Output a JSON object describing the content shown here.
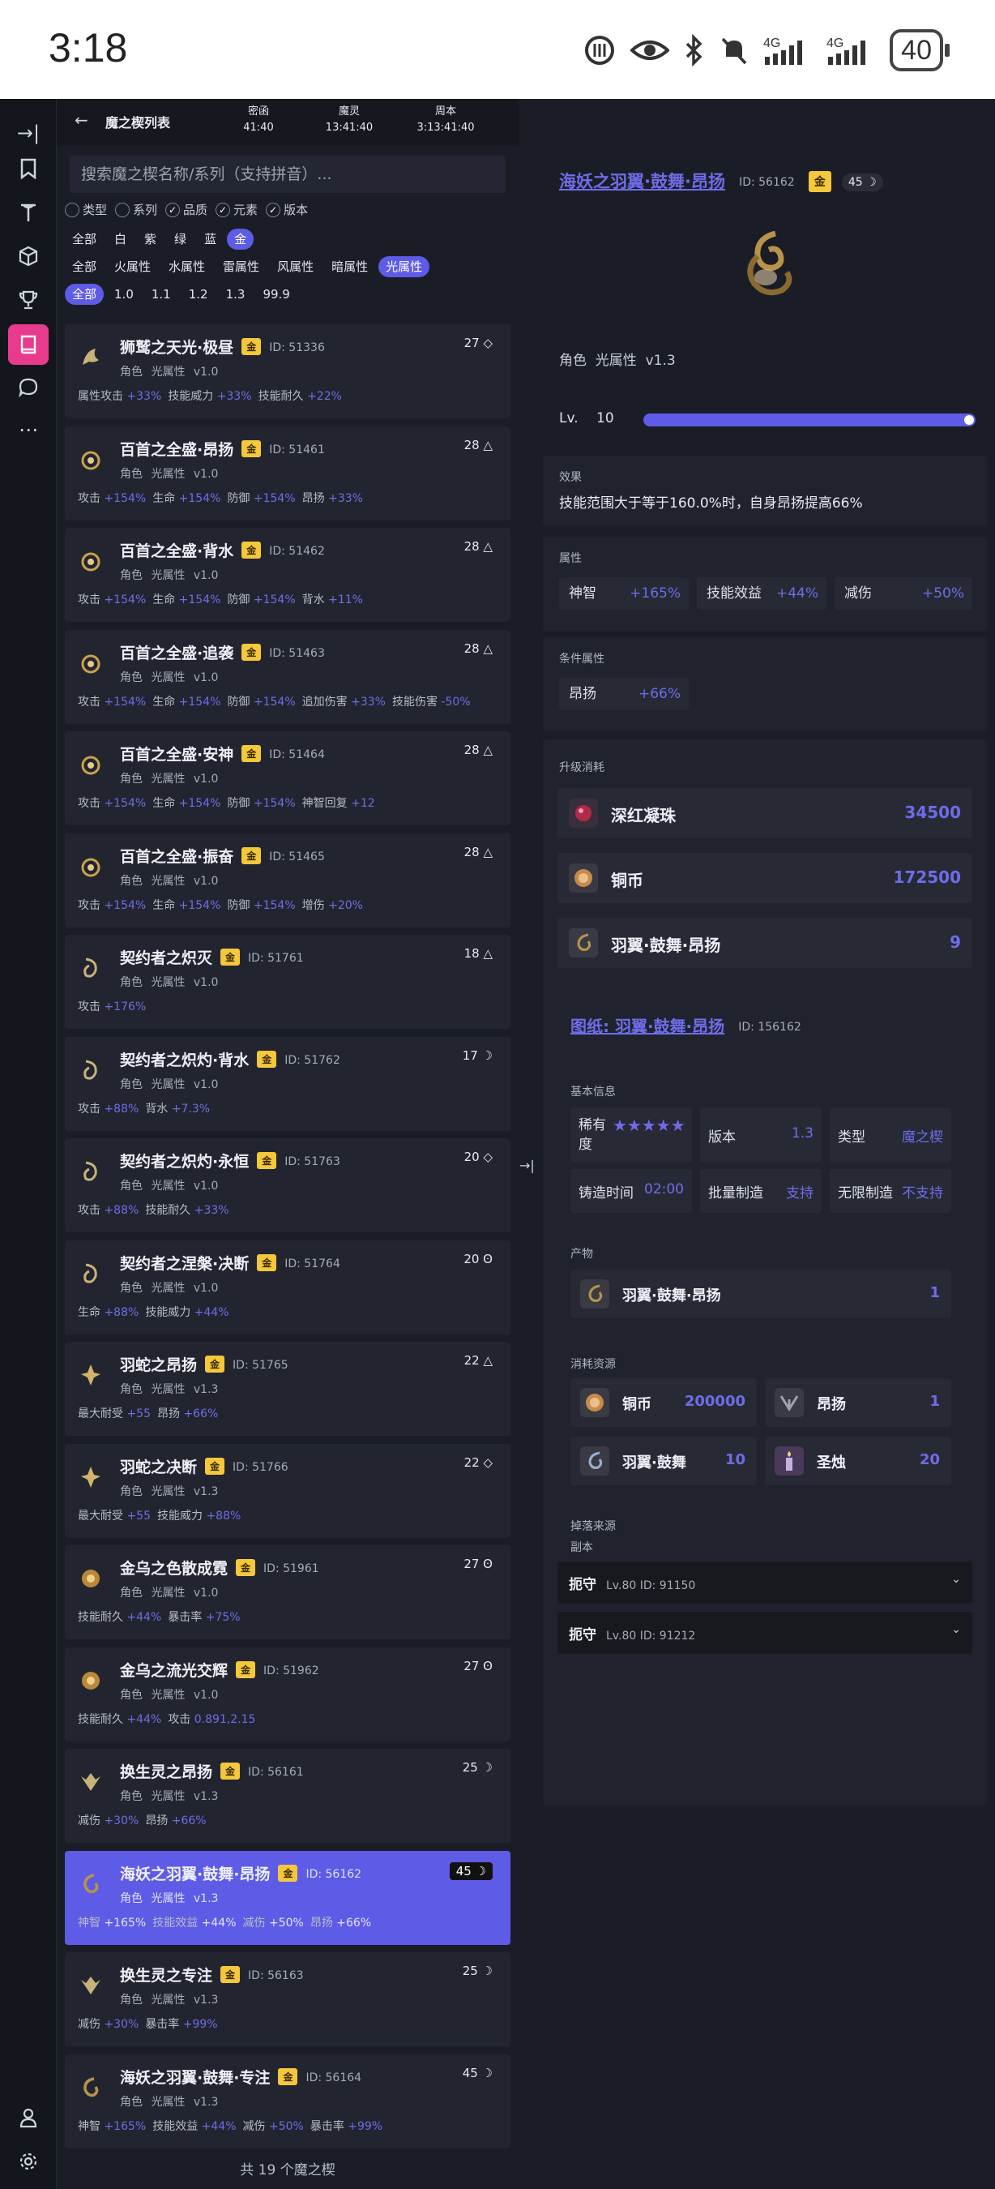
{
  "status": {
    "time": "3:18",
    "battery": "40"
  },
  "nav": {
    "title": "魔之楔列表",
    "timers": [
      {
        "label": "密函",
        "value": "41:40"
      },
      {
        "label": "魔灵",
        "value": "13:41:40"
      },
      {
        "label": "周本",
        "value": "3:13:41:40"
      }
    ]
  },
  "search": {
    "placeholder": "搜索魔之楔名称/系列（支持拼音）..."
  },
  "filters": {
    "toggles": [
      {
        "label": "类型",
        "checked": false
      },
      {
        "label": "系列",
        "checked": false
      },
      {
        "label": "品质",
        "checked": true
      },
      {
        "label": "元素",
        "checked": true
      },
      {
        "label": "版本",
        "checked": true
      }
    ],
    "quality": [
      "全部",
      "白",
      "紫",
      "绿",
      "蓝",
      "金"
    ],
    "element": [
      "全部",
      "火属性",
      "水属性",
      "雷属性",
      "风属性",
      "暗属性",
      "光属性"
    ],
    "version": [
      "全部",
      "1.0",
      "1.1",
      "1.2",
      "1.3",
      "99.9"
    ]
  },
  "gold_label": "金",
  "items": [
    {
      "name": "狮鹫之天光·极昼",
      "id": "ID: 51336",
      "meta": "角色 光属性 v1.0",
      "level": "27 ◇",
      "stats": [
        [
          "属性攻击",
          "+33%"
        ],
        [
          "技能威力",
          "+33%"
        ],
        [
          "技能耐久",
          "+22%"
        ]
      ]
    },
    {
      "name": "百首之全盛·昂扬",
      "id": "ID: 51461",
      "meta": "角色 光属性 v1.0",
      "level": "28 △",
      "stats": [
        [
          "攻击",
          "+154%"
        ],
        [
          "生命",
          "+154%"
        ],
        [
          "防御",
          "+154%"
        ],
        [
          "昂扬",
          "+33%"
        ]
      ]
    },
    {
      "name": "百首之全盛·背水",
      "id": "ID: 51462",
      "meta": "角色 光属性 v1.0",
      "level": "28 △",
      "stats": [
        [
          "攻击",
          "+154%"
        ],
        [
          "生命",
          "+154%"
        ],
        [
          "防御",
          "+154%"
        ],
        [
          "背水",
          "+11%"
        ]
      ]
    },
    {
      "name": "百首之全盛·追袭",
      "id": "ID: 51463",
      "meta": "角色 光属性 v1.0",
      "level": "28 △",
      "stats": [
        [
          "攻击",
          "+154%"
        ],
        [
          "生命",
          "+154%"
        ],
        [
          "防御",
          "+154%"
        ],
        [
          "追加伤害",
          "+33%"
        ],
        [
          "技能伤害",
          "-50%"
        ]
      ]
    },
    {
      "name": "百首之全盛·安神",
      "id": "ID: 51464",
      "meta": "角色 光属性 v1.0",
      "level": "28 △",
      "stats": [
        [
          "攻击",
          "+154%"
        ],
        [
          "生命",
          "+154%"
        ],
        [
          "防御",
          "+154%"
        ],
        [
          "神智回复",
          "+12"
        ]
      ]
    },
    {
      "name": "百首之全盛·振奋",
      "id": "ID: 51465",
      "meta": "角色 光属性 v1.0",
      "level": "28 △",
      "stats": [
        [
          "攻击",
          "+154%"
        ],
        [
          "生命",
          "+154%"
        ],
        [
          "防御",
          "+154%"
        ],
        [
          "增伤",
          "+20%"
        ]
      ]
    },
    {
      "name": "契约者之炽灭",
      "id": "ID: 51761",
      "meta": "角色 光属性 v1.0",
      "level": "18 △",
      "stats": [
        [
          "攻击",
          "+176%"
        ]
      ]
    },
    {
      "name": "契约者之炽灼·背水",
      "id": "ID: 51762",
      "meta": "角色 光属性 v1.0",
      "level": "17 ☽",
      "stats": [
        [
          "攻击",
          "+88%"
        ],
        [
          "背水",
          "+7.3%"
        ]
      ]
    },
    {
      "name": "契约者之炽灼·永恒",
      "id": "ID: 51763",
      "meta": "角色 光属性 v1.0",
      "level": "20 ◇",
      "stats": [
        [
          "攻击",
          "+88%"
        ],
        [
          "技能耐久",
          "+33%"
        ]
      ]
    },
    {
      "name": "契约者之涅槃·决断",
      "id": "ID: 51764",
      "meta": "角色 光属性 v1.0",
      "level": "20 ʘ",
      "stats": [
        [
          "生命",
          "+88%"
        ],
        [
          "技能威力",
          "+44%"
        ]
      ]
    },
    {
      "name": "羽蛇之昂扬",
      "id": "ID: 51765",
      "meta": "角色 光属性 v1.3",
      "level": "22 △",
      "stats": [
        [
          "最大耐受",
          "+55"
        ],
        [
          "昂扬",
          "+66%"
        ]
      ]
    },
    {
      "name": "羽蛇之决断",
      "id": "ID: 51766",
      "meta": "角色 光属性 v1.3",
      "level": "22 ◇",
      "stats": [
        [
          "最大耐受",
          "+55"
        ],
        [
          "技能威力",
          "+88%"
        ]
      ]
    },
    {
      "name": "金乌之色散成霓",
      "id": "ID: 51961",
      "meta": "角色 光属性 v1.0",
      "level": "27 ʘ",
      "stats": [
        [
          "技能耐久",
          "+44%"
        ],
        [
          "暴击率",
          "+75%"
        ]
      ]
    },
    {
      "name": "金乌之流光交辉",
      "id": "ID: 51962",
      "meta": "角色 光属性 v1.0",
      "level": "27 ʘ",
      "stats": [
        [
          "技能耐久",
          "+44%"
        ],
        [
          "攻击",
          "0.891,2.15"
        ]
      ]
    },
    {
      "name": "换生灵之昂扬",
      "id": "ID: 56161",
      "meta": "角色 光属性 v1.3",
      "level": "25 ☽",
      "stats": [
        [
          "减伤",
          "+30%"
        ],
        [
          "昂扬",
          "+66%"
        ]
      ]
    },
    {
      "name": "海妖之羽翼·鼓舞·昂扬",
      "id": "ID: 56162",
      "meta": "角色 光属性 v1.3",
      "level": "45 ☽",
      "selected": true,
      "stats": [
        [
          "神智",
          "+165%"
        ],
        [
          "技能效益",
          "+44%"
        ],
        [
          "减伤",
          "+50%"
        ],
        [
          "昂扬",
          "+66%"
        ]
      ]
    },
    {
      "name": "换生灵之专注",
      "id": "ID: 56163",
      "meta": "角色 光属性 v1.3",
      "level": "25 ☽",
      "stats": [
        [
          "减伤",
          "+30%"
        ],
        [
          "暴击率",
          "+99%"
        ]
      ]
    },
    {
      "name": "海妖之羽翼·鼓舞·专注",
      "id": "ID: 56164",
      "meta": "角色 光属性 v1.3",
      "level": "45 ☽",
      "stats": [
        [
          "神智",
          "+165%"
        ],
        [
          "技能效益",
          "+44%"
        ],
        [
          "减伤",
          "+50%"
        ],
        [
          "暴击率",
          "+99%"
        ]
      ]
    }
  ],
  "total": "共 19 个魔之楔",
  "detail": {
    "name": "海妖之羽翼·鼓舞·昂扬",
    "id": "ID: 56162",
    "level_badge": "45 ☽",
    "meta": "角色  光属性  v1.3",
    "lv_label": "Lv.",
    "lv_value": "10",
    "lv_progress": 1.0,
    "effect_label": "效果",
    "effect_text": "技能范围大于等于160.0%时，自身昂扬提高66%",
    "attr_label": "属性",
    "attrs": [
      [
        "神智",
        "+165%"
      ],
      [
        "技能效益",
        "+44%"
      ],
      [
        "减伤",
        "+50%"
      ]
    ],
    "cond_label": "条件属性",
    "cond_attrs": [
      [
        "昂扬",
        "+66%"
      ]
    ],
    "upgrade_label": "升级消耗",
    "upgrade": [
      [
        "深红凝珠",
        "34500"
      ],
      [
        "铜币",
        "172500"
      ],
      [
        "羽翼·鼓舞·昂扬",
        "9"
      ]
    ]
  },
  "blueprint": {
    "name": "图纸: 羽翼·鼓舞·昂扬",
    "id": "ID: 156162",
    "basic_label": "基本信息",
    "rarity_label": "稀有度",
    "rarity_stars": 5,
    "version_label": "版本",
    "version_value": "1.3",
    "type_label": "类型",
    "type_value": "魔之楔",
    "forge_label": "铸造时间",
    "forge_value": "02:00",
    "batch_label": "批量制造",
    "batch_value": "支持",
    "infinite_label": "无限制造",
    "infinite_value": "不支持",
    "product_label": "产物",
    "product": [
      "羽翼·鼓舞·昂扬",
      "1"
    ],
    "materials_label": "消耗资源",
    "materials": [
      [
        "铜币",
        "200000"
      ],
      [
        "昂扬",
        "1"
      ],
      [
        "羽翼·鼓舞",
        "10"
      ],
      [
        "圣烛",
        "20"
      ]
    ],
    "drop_label": "掉落来源",
    "drop_sub": "副本",
    "drops": [
      [
        "扼守",
        "Lv.80  ID: 91150"
      ],
      [
        "扼守",
        "Lv.80  ID: 91212"
      ]
    ]
  },
  "colors": {
    "accent": "#5e5be6",
    "gold": "#f5c73b",
    "rail_active": "#e93b8d"
  }
}
